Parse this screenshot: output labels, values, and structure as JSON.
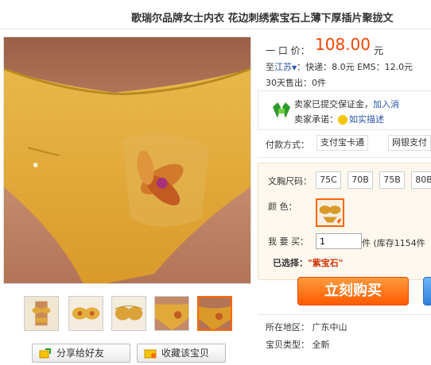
{
  "product": {
    "title": "歌瑞尔品牌女士内衣 花边刺绣紫宝石上薄下厚插片聚拢文"
  },
  "price": {
    "label": "一 口 价：",
    "value": "108.00",
    "unit": "元"
  },
  "shipping": {
    "prefix": "至",
    "location": "江苏",
    "dropdown": "▼",
    "text": "：快递：8.0元  EMS：12.0元"
  },
  "sales": {
    "text": "30天售出：0件"
  },
  "seller": {
    "line1_text": "卖家已提交保证金，",
    "line1_link": "加入消",
    "line2_text": "卖家承诺：",
    "line2_link": "如实描述"
  },
  "payment": {
    "label": "付款方式：",
    "options": [
      "支付宝卡通",
      "网银支付"
    ]
  },
  "sku": {
    "size_label": "文胸尺码：",
    "sizes": [
      "75C",
      "70B",
      "75B",
      "80B"
    ],
    "color_label": "颜    色：",
    "qty_label": "我 要 买：",
    "qty_value": "1",
    "qty_stock": "件 (库存1154件",
    "chosen_label": "已选择：",
    "chosen_value": "\"紫宝石\""
  },
  "actions": {
    "buy": "立刻购买",
    "share": "分享给好友",
    "favorite": "收藏该宝贝"
  },
  "details": {
    "region": "所在地区：  广东中山",
    "condition": "宝贝类型：  全新"
  },
  "colors": {
    "price": "#ff4400",
    "link": "#2953a6",
    "buy_button": "#ff5a00"
  }
}
